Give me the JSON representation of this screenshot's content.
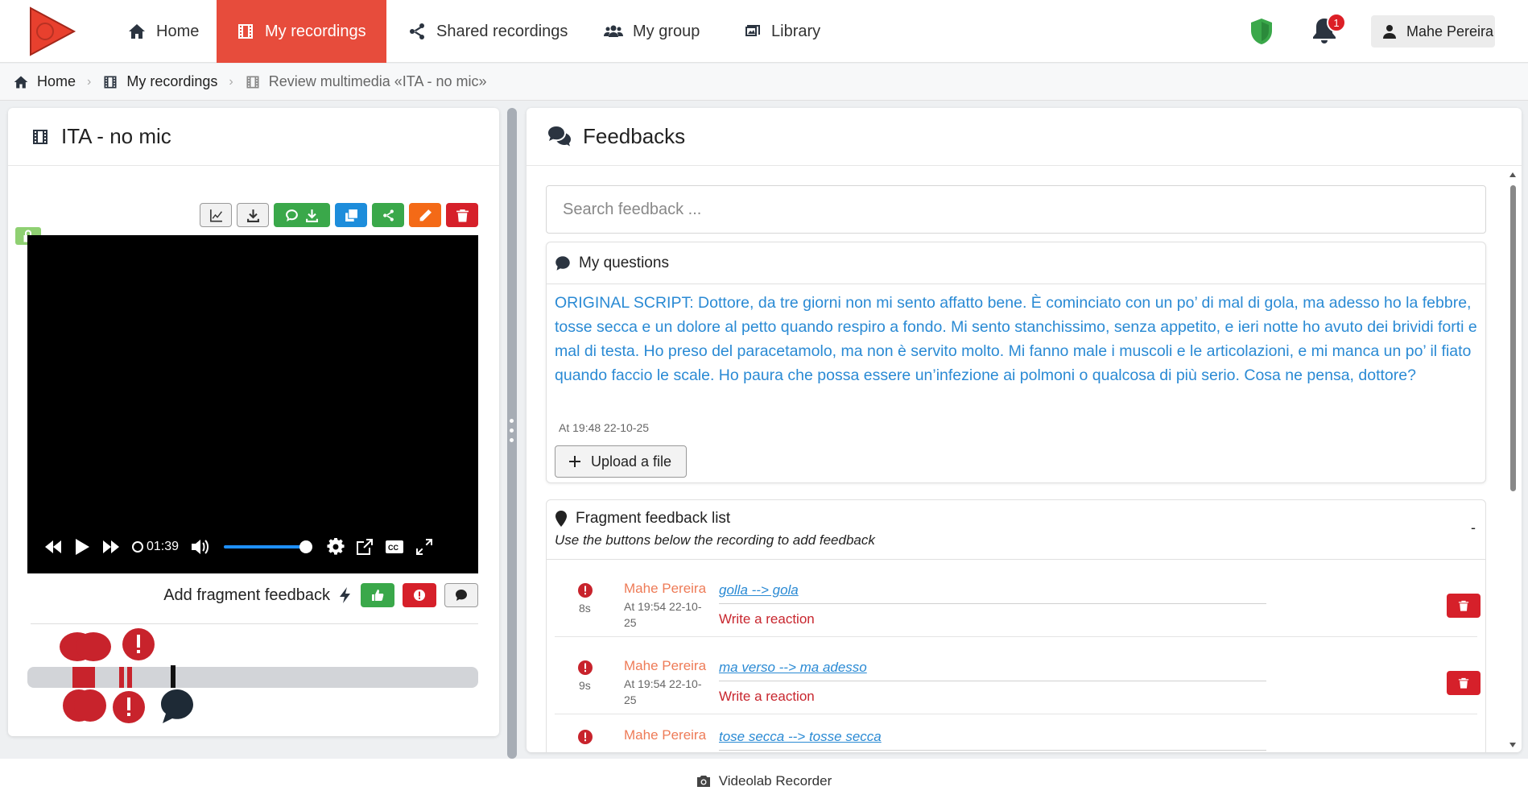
{
  "nav": {
    "items": [
      {
        "label": "Home",
        "icon": "home-icon"
      },
      {
        "label": "My recordings",
        "icon": "film-icon",
        "active": true
      },
      {
        "label": "Shared recordings",
        "icon": "share-icon"
      },
      {
        "label": "My group",
        "icon": "users-icon"
      },
      {
        "label": "Library",
        "icon": "photo-library-icon"
      }
    ],
    "notifications_count": "1",
    "user_name": "Mahe Pereira",
    "accent_color": "#e74c3c"
  },
  "breadcrumb": {
    "home": "Home",
    "recordings": "My recordings",
    "current": "Review multimedia «ITA - no mic»"
  },
  "recording": {
    "title": "ITA - no mic",
    "video": {
      "time": "01:39",
      "volume_percent": 100
    },
    "add_feedback_label": "Add fragment feedback"
  },
  "feedbacks": {
    "title": "Feedbacks",
    "search_placeholder": "Search feedback ...",
    "questions": {
      "title": "My questions",
      "text": "ORIGINAL SCRIPT: Dottore, da tre giorni non mi sento affatto bene. È cominciato con un po’ di mal di gola, ma adesso ho la febbre, tosse secca e un dolore al petto quando respiro a fondo. Mi sento stanchissimo, senza appetito, e ieri notte ho avuto dei brividi forti e mal di testa. Ho preso del paracetamolo, ma non è servito molto. Mi fanno male i muscoli e le articolazioni, e mi manca un po’ il fiato quando faccio le scale. Ho paura che possa essere un’infezione ai polmoni o qualcosa di più serio. Cosa ne pensa, dottore?",
      "timestamp": "At 19:48 22-10-25",
      "upload_label": "Upload a file"
    },
    "fragments": {
      "title": "Fragment feedback list",
      "subtitle": "Use the buttons below the recording to add feedback",
      "collapse": "-",
      "items": [
        {
          "sec": "8s",
          "author": "Mahe Pereira",
          "date": "At 19:54 22-10-25",
          "correction": "golla --> gola",
          "reaction": "Write a reaction"
        },
        {
          "sec": "9s",
          "author": "Mahe Pereira",
          "date": "At 19:54 22-10-25",
          "correction": "ma verso --> ma adesso",
          "reaction": "Write a reaction"
        },
        {
          "sec": "",
          "author": "Mahe Pereira",
          "date": "",
          "correction": "tose secca --> tosse secca",
          "reaction": ""
        }
      ]
    }
  },
  "footer": {
    "label": "Videolab Recorder"
  }
}
